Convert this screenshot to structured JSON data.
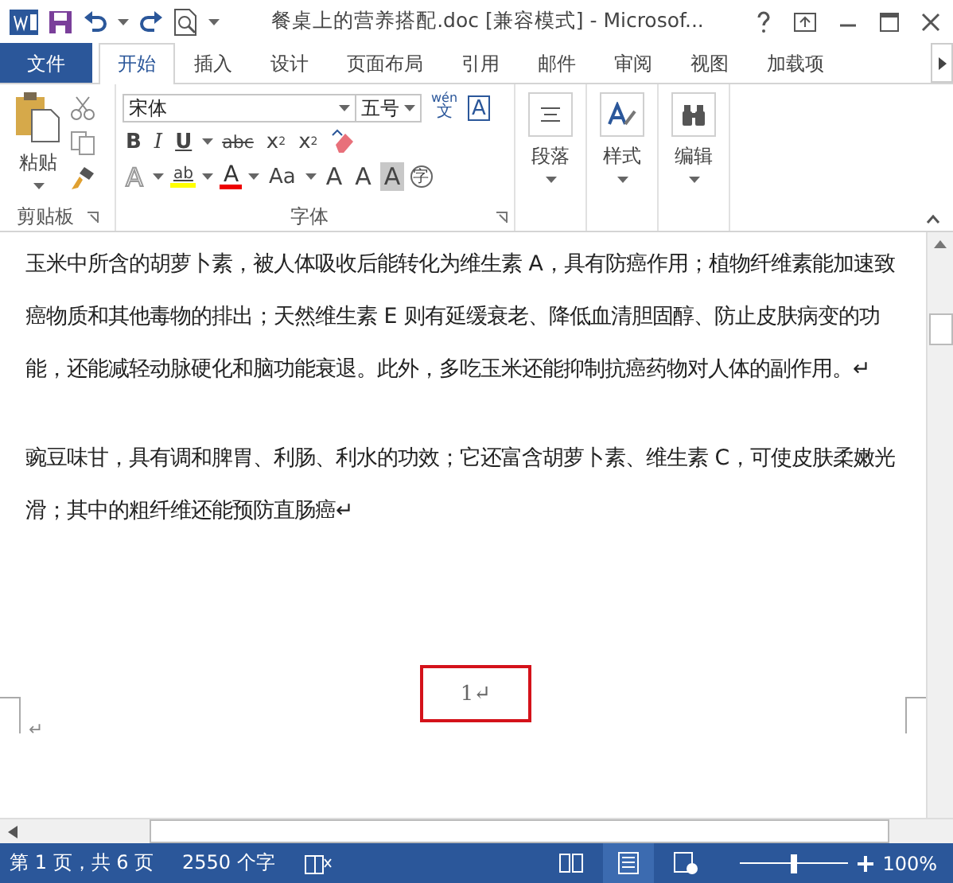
{
  "window": {
    "title": "餐桌上的营养搭配.doc [兼容模式] - Microsof..."
  },
  "tabs": [
    {
      "label": "文件",
      "kind": "file",
      "selected": false
    },
    {
      "label": "开始",
      "kind": "tab",
      "selected": true
    },
    {
      "label": "插入",
      "kind": "tab",
      "selected": false
    },
    {
      "label": "设计",
      "kind": "tab",
      "selected": false
    },
    {
      "label": "页面布局",
      "kind": "tab",
      "selected": false
    },
    {
      "label": "引用",
      "kind": "tab",
      "selected": false
    },
    {
      "label": "邮件",
      "kind": "tab",
      "selected": false
    },
    {
      "label": "审阅",
      "kind": "tab",
      "selected": false
    },
    {
      "label": "视图",
      "kind": "tab",
      "selected": false
    },
    {
      "label": "加载项",
      "kind": "tab",
      "selected": false
    }
  ],
  "clipboard": {
    "paste": "粘贴",
    "label": "剪贴板"
  },
  "font": {
    "name": "宋体",
    "size": "五号",
    "pinyin": "wén",
    "pinyin_char": "文",
    "border_char": "A",
    "label": "字体",
    "row_2": [
      {
        "kind": "bold",
        "label": "B"
      },
      {
        "kind": "italic",
        "label": "I"
      },
      {
        "kind": "underline",
        "label": "U"
      },
      {
        "kind": "strike",
        "label": "abc"
      },
      {
        "kind": "sub",
        "label": "x",
        "script": "2"
      },
      {
        "kind": "sup",
        "label": "x",
        "script": "2"
      },
      {
        "kind": "clear"
      }
    ],
    "row_3": [
      {
        "kind": "effects",
        "label": "A"
      },
      {
        "kind": "highlight",
        "label": "ab"
      },
      {
        "kind": "color",
        "label": "A"
      },
      {
        "kind": "case",
        "label": "Aa"
      },
      {
        "kind": "grow",
        "label": "A"
      },
      {
        "kind": "shrink",
        "label": "A"
      },
      {
        "kind": "shade",
        "label": "A"
      },
      {
        "kind": "enclose",
        "label": "字"
      }
    ]
  },
  "big_buttons": [
    {
      "kind": "paragraph",
      "label": "段落"
    },
    {
      "kind": "styles",
      "label": "样式"
    },
    {
      "kind": "editing",
      "label": "编辑"
    }
  ],
  "document": {
    "paragraphs": [
      "玉米中所含的胡萝卜素，被人体吸收后能转化为维生素 A，具有防癌作用；植物纤维素能加速致癌物质和其他毒物的排出；天然维生素 E 则有延缓衰老、降低血清胆固醇、防止皮肤病变的功能，还能减轻动脉硬化和脑功能衰退。此外，多吃玉米还能抑制抗癌药物对人体的副作用。↵",
      "豌豆味甘，具有调和脾胃、利肠、利水的功效；它还富含胡萝卜素、维生素 C，可使皮肤柔嫩光滑；其中的粗纤维还能预防直肠癌↵"
    ],
    "page_number": "1↵",
    "footer_mark": "↵"
  },
  "status_bar": {
    "page": "第 1 页，共 6 页",
    "words": "2550 个字",
    "zoom": {
      "text": "100%",
      "level": 0.5
    },
    "views": [
      {
        "kind": "read",
        "selected": false
      },
      {
        "kind": "print",
        "selected": true
      },
      {
        "kind": "web",
        "selected": false
      }
    ]
  }
}
